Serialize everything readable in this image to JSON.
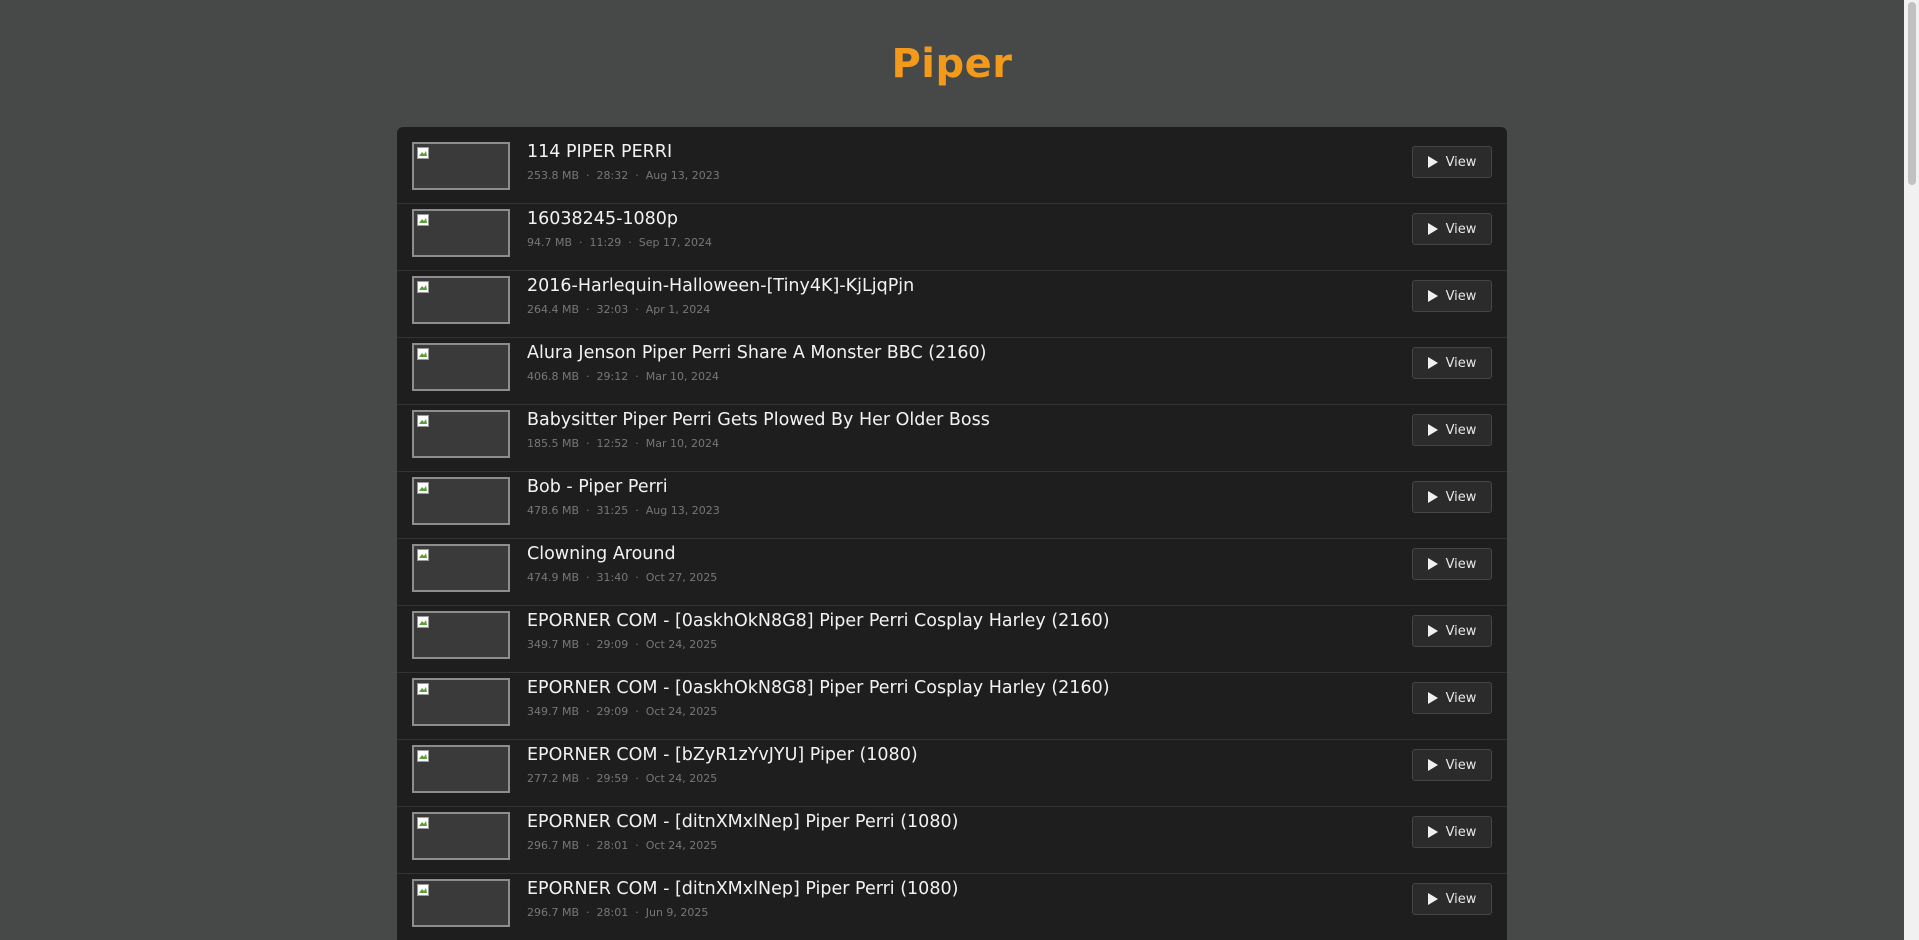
{
  "header": {
    "title": "Piper"
  },
  "view_label": "View",
  "items": [
    {
      "title": "114 PIPER PERRI",
      "size": "253.8 MB",
      "duration": "28:32",
      "date": "Aug 13, 2023"
    },
    {
      "title": "16038245-1080p",
      "size": "94.7 MB",
      "duration": "11:29",
      "date": "Sep 17, 2024"
    },
    {
      "title": "2016-Harlequin-Halloween-[Tiny4K]-KjLjqPjn",
      "size": "264.4 MB",
      "duration": "32:03",
      "date": "Apr 1, 2024"
    },
    {
      "title": "Alura Jenson Piper Perri Share A Monster BBC (2160)",
      "size": "406.8 MB",
      "duration": "29:12",
      "date": "Mar 10, 2024"
    },
    {
      "title": "Babysitter Piper Perri Gets Plowed By Her Older Boss",
      "size": "185.5 MB",
      "duration": "12:52",
      "date": "Mar 10, 2024"
    },
    {
      "title": "Bob - Piper Perri",
      "size": "478.6 MB",
      "duration": "31:25",
      "date": "Aug 13, 2023"
    },
    {
      "title": "Clowning Around",
      "size": "474.9 MB",
      "duration": "31:40",
      "date": "Oct 27, 2025"
    },
    {
      "title": "EPORNER COM - [0askhOkN8G8] Piper Perri Cosplay Harley (2160)",
      "size": "349.7 MB",
      "duration": "29:09",
      "date": "Oct 24, 2025"
    },
    {
      "title": "EPORNER COM - [0askhOkN8G8] Piper Perri Cosplay Harley (2160)",
      "size": "349.7 MB",
      "duration": "29:09",
      "date": "Oct 24, 2025"
    },
    {
      "title": "EPORNER COM - [bZyR1zYvJYU] Piper (1080)",
      "size": "277.2 MB",
      "duration": "29:59",
      "date": "Oct 24, 2025"
    },
    {
      "title": "EPORNER COM - [ditnXMxlNep] Piper Perri (1080)",
      "size": "296.7 MB",
      "duration": "28:01",
      "date": "Oct 24, 2025"
    },
    {
      "title": "EPORNER COM - [ditnXMxlNep] Piper Perri (1080)",
      "size": "296.7 MB",
      "duration": "28:01",
      "date": "Jun 9, 2025"
    }
  ]
}
